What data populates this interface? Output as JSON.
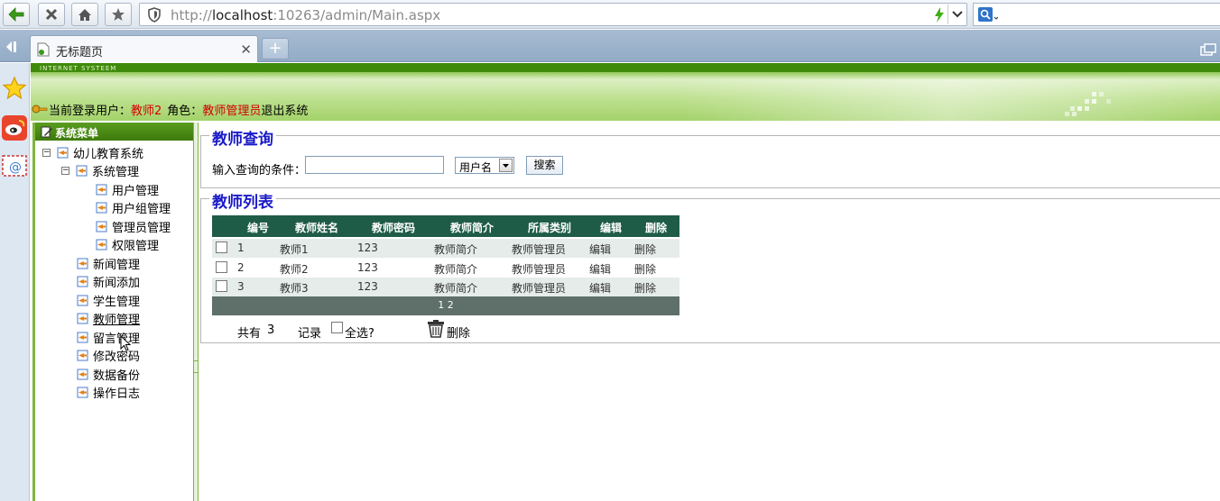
{
  "browser": {
    "url_prefix": "http://",
    "url_host": "localhost",
    "url_rest": ":10263/admin/Main.aspx",
    "tab_title": "无标题页",
    "new_tab": "+"
  },
  "header": {
    "brand": "INTERNET SYSTEEM",
    "current_user_label": "当前登录用户：",
    "current_user": "教师2",
    "role_label": "角色：",
    "role": "教师管理员",
    "logout": "退出系统"
  },
  "menu": {
    "title": "系统菜单",
    "root": "幼儿教育系统",
    "system": "系统管理",
    "system_items": [
      "用户管理",
      "用户组管理",
      "管理员管理",
      "权限管理"
    ],
    "items": [
      "新闻管理",
      "新闻添加",
      "学生管理",
      "教师管理",
      "留言管理",
      "修改密码",
      "数据备份",
      "操作日志"
    ]
  },
  "query": {
    "title": "教师查询",
    "label": "输入查询的条件：",
    "input_value": "",
    "select_value": "用户名",
    "search_button": "搜索"
  },
  "list": {
    "title": "教师列表",
    "columns": [
      "编号",
      "教师姓名",
      "教师密码",
      "教师简介",
      "所属类别",
      "编辑",
      "删除"
    ],
    "rows": [
      [
        "1",
        "教师1",
        "123",
        "教师简介",
        "教师管理员",
        "编辑",
        "删除"
      ],
      [
        "2",
        "教师2",
        "123",
        "教师简介",
        "教师管理员",
        "编辑",
        "删除"
      ],
      [
        "3",
        "教师3",
        "123",
        "教师简介",
        "教师管理员",
        "编辑",
        "删除"
      ]
    ],
    "pager": "1 2",
    "total_prefix": "共有",
    "total_count": "3",
    "total_suffix": "记录",
    "select_all": "全选?",
    "delete": "删除"
  },
  "colors": {
    "accent_green": "#4f9a17",
    "grid_head": "#1f5c48",
    "title_blue": "#1a1ac8",
    "red": "#d40000"
  }
}
